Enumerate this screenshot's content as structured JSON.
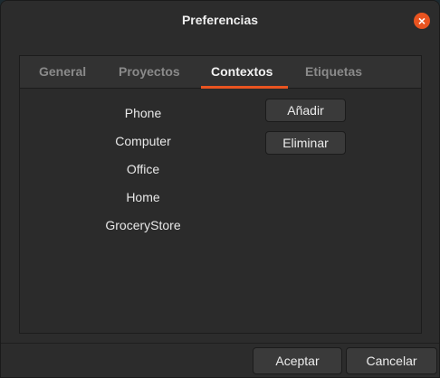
{
  "window": {
    "title": "Preferencias",
    "close_glyph": "×",
    "accent_color": "#e95420"
  },
  "tabs": [
    {
      "label": "General",
      "active": false
    },
    {
      "label": "Proyectos",
      "active": false
    },
    {
      "label": "Contextos",
      "active": true
    },
    {
      "label": "Etiquetas",
      "active": false
    }
  ],
  "contexts": [
    "Phone",
    "Computer",
    "Office",
    "Home",
    "GroceryStore"
  ],
  "actions": {
    "add_label": "Añadir",
    "remove_label": "Eliminar"
  },
  "footer": {
    "accept_label": "Aceptar",
    "cancel_label": "Cancelar"
  }
}
